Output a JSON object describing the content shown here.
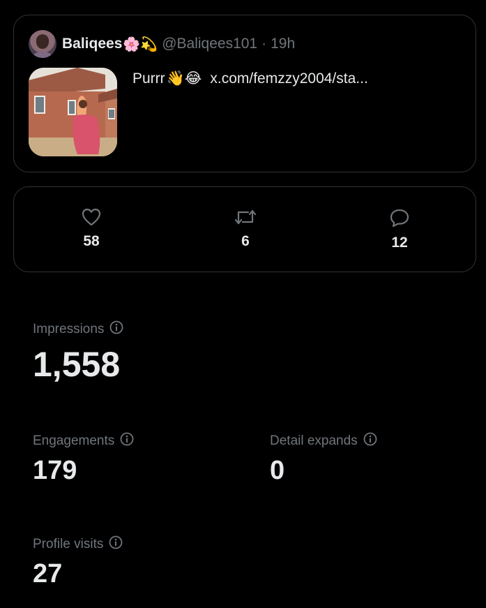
{
  "tweet": {
    "display_name": "Baliqees",
    "name_emojis": "🌸💫",
    "handle": "@Baliqees101",
    "separator": "·",
    "time": "19h",
    "text": "Purrr",
    "text_emojis": "👋😂",
    "link": "x.com/femzzy2004/sta..."
  },
  "engagement_bar": {
    "likes": "58",
    "reposts": "6",
    "replies": "12"
  },
  "metrics": {
    "impressions": {
      "label": "Impressions",
      "value": "1,558"
    },
    "engagements": {
      "label": "Engagements",
      "value": "179"
    },
    "detail_expands": {
      "label": "Detail expands",
      "value": "0"
    },
    "profile_visits": {
      "label": "Profile visits",
      "value": "27"
    }
  },
  "colors": {
    "background": "#000000",
    "border": "#2f3336",
    "primary_text": "#e7e9ea",
    "secondary_text": "#71767b"
  },
  "icons": {
    "like": "heart-icon",
    "repost": "repost-icon",
    "reply": "reply-bubble-icon",
    "info": "info-icon"
  }
}
